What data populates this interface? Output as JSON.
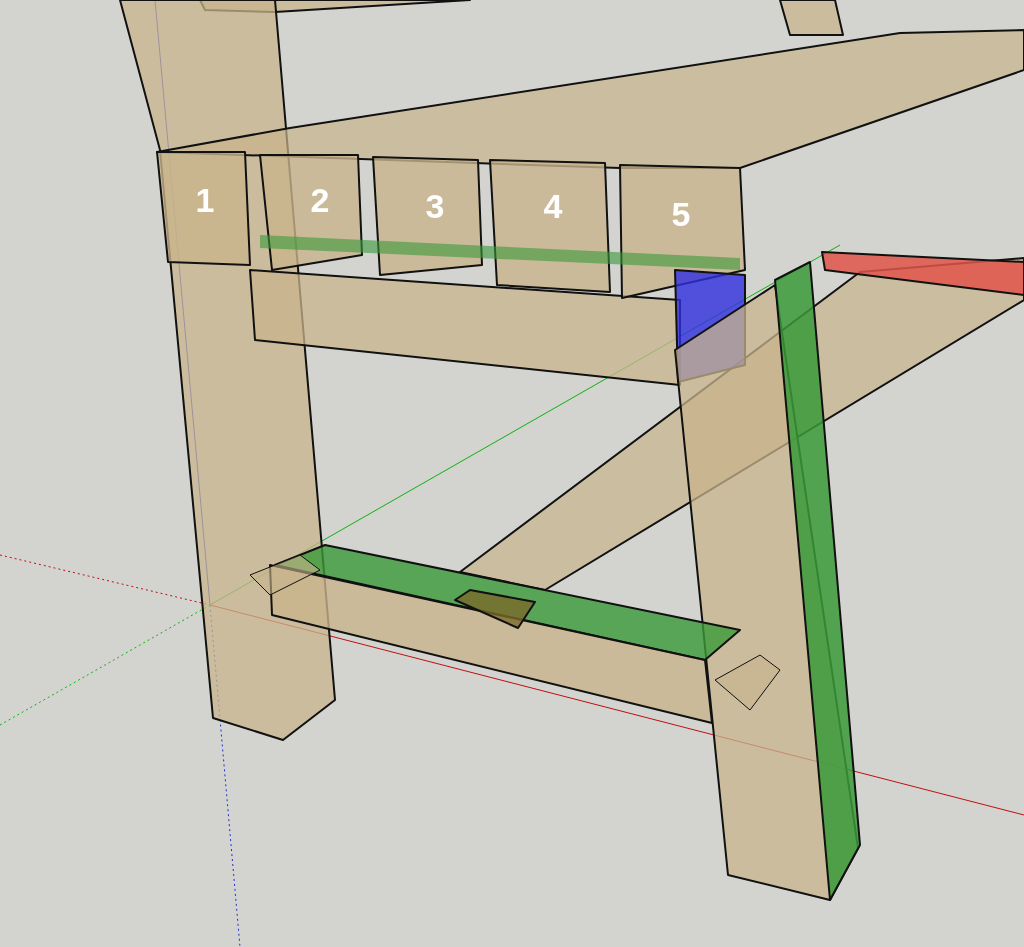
{
  "viewport": {
    "board_labels": [
      {
        "text": "1"
      },
      {
        "text": "2"
      },
      {
        "text": "3"
      },
      {
        "text": "4"
      },
      {
        "text": "5"
      }
    ]
  }
}
